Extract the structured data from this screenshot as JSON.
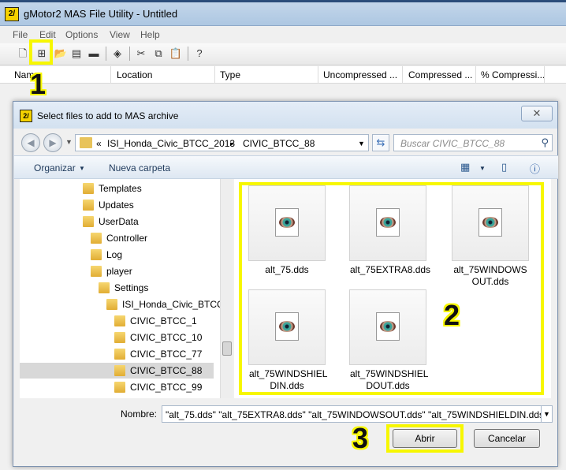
{
  "app": {
    "icon_text": "2/",
    "title": "gMotor2 MAS File Utility - Untitled",
    "menus": [
      "File",
      "Edit",
      "Options",
      "View",
      "Help"
    ],
    "columns": [
      "Name",
      "Location",
      "Type",
      "Uncompressed ...",
      "Compressed ...",
      "% Compressi..."
    ]
  },
  "annotations": {
    "one": "1",
    "two": "2",
    "three": "3"
  },
  "dialog": {
    "title": "Select files to add to MAS archive",
    "close_glyph": "✕",
    "breadcrumb": {
      "prefix": "«",
      "parent": "ISI_Honda_Civic_BTCC_2013",
      "sep": "▸",
      "current": "CIVIC_BTCC_88"
    },
    "search_placeholder": "Buscar CIVIC_BTCC_88",
    "commands": {
      "organize": "Organizar",
      "new_folder": "Nueva carpeta"
    },
    "tree": [
      {
        "label": "Templates"
      },
      {
        "label": "Updates"
      },
      {
        "label": "UserData"
      },
      {
        "label": "Controller"
      },
      {
        "label": "Log"
      },
      {
        "label": "player"
      },
      {
        "label": "Settings"
      },
      {
        "label": "ISI_Honda_Civic_BTCC_"
      },
      {
        "label": "CIVIC_BTCC_1"
      },
      {
        "label": "CIVIC_BTCC_10"
      },
      {
        "label": "CIVIC_BTCC_77"
      },
      {
        "label": "CIVIC_BTCC_88"
      },
      {
        "label": "CIVIC_BTCC_99"
      }
    ],
    "files": [
      {
        "line1": "alt_75.dds",
        "line2": ""
      },
      {
        "line1": "alt_75EXTRA8.dds",
        "line2": ""
      },
      {
        "line1": "alt_75WINDOWS",
        "line2": "OUT.dds"
      },
      {
        "line1": "alt_75WINDSHIEL",
        "line2": "DIN.dds"
      },
      {
        "line1": "alt_75WINDSHIEL",
        "line2": "DOUT.dds"
      }
    ],
    "filename_label": "Nombre:",
    "filename_value": "\"alt_75.dds\" \"alt_75EXTRA8.dds\" \"alt_75WINDOWSOUT.dds\" \"alt_75WINDSHIELDIN.dds\"",
    "open_button": "Abrir",
    "cancel_button": "Cancelar"
  }
}
